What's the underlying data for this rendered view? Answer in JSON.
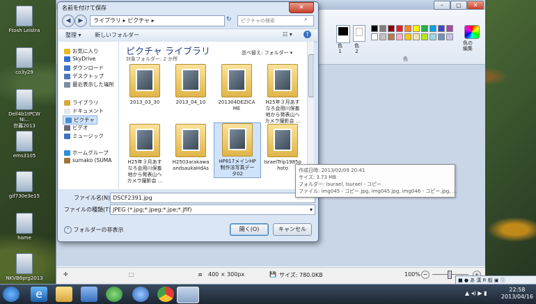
{
  "desktop": {
    "icons": [
      {
        "label": "Ftosh Leistra"
      },
      {
        "label": "co3y29"
      },
      {
        "label": "Dell4b1tPCW Ni...\n世暮2013"
      },
      {
        "label": "ems3105"
      },
      {
        "label": "gif730e3e15"
      },
      {
        "label": "home"
      },
      {
        "label": "NKVB6prg2013"
      }
    ]
  },
  "paint": {
    "ribbon": {
      "color1_label": "色\n1",
      "color2_label": "色\n2",
      "edit_colors_label": "色の\n編集",
      "group_label": "色"
    },
    "status": {
      "size_text": "400 × 300px",
      "filesize_text": "サイズ: 780.0KB",
      "zoom_text": "100%",
      "zoom_minus": "−",
      "zoom_plus": "+"
    },
    "colors": {
      "palette": [
        "#000000",
        "#7f7f7f",
        "#880015",
        "#ed1c24",
        "#ff7f27",
        "#fff200",
        "#22b14c",
        "#00a2e8",
        "#3f48cc",
        "#a349a4",
        "#ffffff",
        "#c3c3c3",
        "#b97a57",
        "#ffaec9",
        "#ffc90e",
        "#efe4b0",
        "#b5e61d",
        "#99d9ea",
        "#7092be",
        "#c8bfe7"
      ]
    }
  },
  "dialog": {
    "title": "名前を付けて保存",
    "close": "✕",
    "breadcrumb": "ライブラリ ▸ ピクチャ ▸",
    "search_placeholder": "ピクチャの検索",
    "toolbar": {
      "organize": "整理 ▾",
      "new_folder": "新しいフォルダー"
    },
    "nav": [
      {
        "label": "お気に入り",
        "icon": "star-icon",
        "color": "#e8b923"
      },
      {
        "label": "SkyDrive",
        "icon": "cloud-icon",
        "color": "#2f6fcf"
      },
      {
        "label": "ダウンロード",
        "icon": "download-icon",
        "color": "#3b73c7"
      },
      {
        "label": "デスクトップ",
        "icon": "desktop-icon",
        "color": "#4a79b5"
      },
      {
        "label": "最近表示した場所",
        "icon": "recent-icon",
        "color": "#7d8ca0"
      },
      {
        "label": "ライブラリ",
        "icon": "library-icon",
        "color": "#d7a73a"
      },
      {
        "label": "ドキュメント",
        "icon": "document-icon",
        "color": "#e2e8ef"
      },
      {
        "label": "ピクチャ",
        "icon": "picture-icon",
        "color": "#4c8bd4"
      },
      {
        "label": "ビデオ",
        "icon": "video-icon",
        "color": "#6a6a7a"
      },
      {
        "label": "ミュージック",
        "icon": "music-icon",
        "color": "#3a73c2"
      },
      {
        "label": "ホームグループ",
        "icon": "homegroup-icon",
        "color": "#2f8fd8"
      },
      {
        "label": "sumako (SUMA",
        "icon": "user-icon",
        "color": "#a0743c"
      }
    ],
    "library_title": "ピクチャ ライブラリ",
    "library_sub": "対象フォルダー: 2 か所",
    "sort_label": "並べ替え:  フォルダー ▾",
    "tiles": [
      {
        "label": "2013_03_30"
      },
      {
        "label": "2013_04_10"
      },
      {
        "label": "201304DEZICA\nME"
      },
      {
        "label": "H25年３月あす\nなろ会用川俣畜\n地から発表山へ\nカメラ撮影会 ..."
      },
      {
        "label": "H25年３月あす\nなろ会用川俣畜\n地から発表山へ\nカメラ撮影会 ..."
      },
      {
        "label": "H2503arakawa\nandsaukaHdAs"
      },
      {
        "label": "HP817メインHP\n制作法写真デー\nタ02"
      },
      {
        "label": "IsraelTrip1985p\nhoto"
      }
    ],
    "tooltip": {
      "created": "作成日時: 2013/02/09 20:41",
      "size": "サイズ: 3.73 MB",
      "folders": "フォルダー: Isurael, Isurael - コピー",
      "files": "ファイル: img045 - コピー.jpg, img045.jpg, img046 - コピー.jpg, ..."
    },
    "filename_label": "ファイル名(N):",
    "filename_value": "DSCF2391.jpg",
    "filetype_label": "ファイルの種類(T):",
    "filetype_value": "JPEG (*.jpg;*.jpeg;*.jpe;*.jfif)",
    "hide_folders": "フォルダーの非表示",
    "save_button": "開く(O)",
    "cancel_button": "キャンセル"
  },
  "ime_bar": "■ ● あ 漢 R 般 ▣ ⓘ",
  "taskbar": {
    "time": "22:58",
    "date": "2013/04/16"
  }
}
